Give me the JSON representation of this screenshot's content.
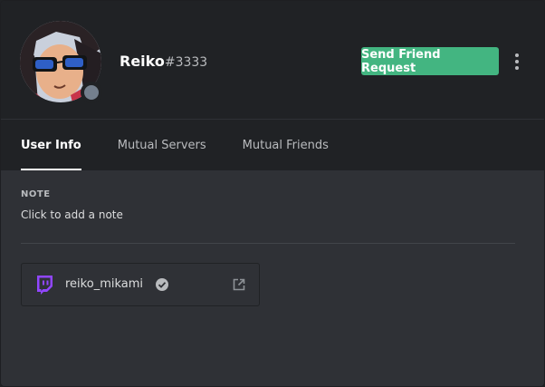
{
  "profile": {
    "username": "Reiko",
    "discriminator": "#3333",
    "status": "offline"
  },
  "actions": {
    "friend_request_label": "Send Friend Request"
  },
  "tabs": [
    {
      "label": "User Info",
      "active": true
    },
    {
      "label": "Mutual Servers",
      "active": false
    },
    {
      "label": "Mutual Friends",
      "active": false
    }
  ],
  "note": {
    "title": "NOTE",
    "placeholder": "Click to add a note"
  },
  "connected_accounts": [
    {
      "platform": "twitch",
      "name": "reiko_mikami",
      "verified": true
    }
  ],
  "colors": {
    "accent_green": "#43b581",
    "twitch_purple": "#9146ff",
    "offline_gray": "#747f8d"
  }
}
